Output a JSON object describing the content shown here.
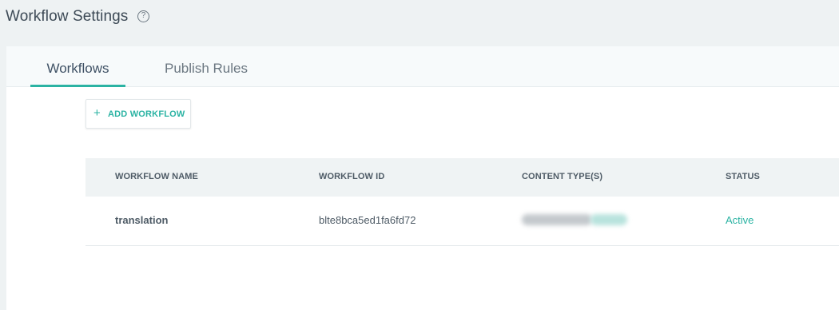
{
  "header": {
    "title": "Workflow Settings",
    "help_symbol": "?"
  },
  "tabs": [
    {
      "label": "Workflows",
      "active": true
    },
    {
      "label": "Publish Rules",
      "active": false
    }
  ],
  "toolbar": {
    "add_symbol": "+",
    "add_label": "ADD WORKFLOW"
  },
  "table": {
    "columns": [
      "WORKFLOW NAME",
      "WORKFLOW ID",
      "CONTENT TYPE(S)",
      "STATUS"
    ],
    "rows": [
      {
        "name": "translation",
        "id": "blte8bca5ed1fa6fd72",
        "content_types": "",
        "status": "Active"
      }
    ]
  },
  "colors": {
    "accent": "#2bb3a3",
    "text": "#4e5b66",
    "header_bg": "#eef2f3"
  }
}
